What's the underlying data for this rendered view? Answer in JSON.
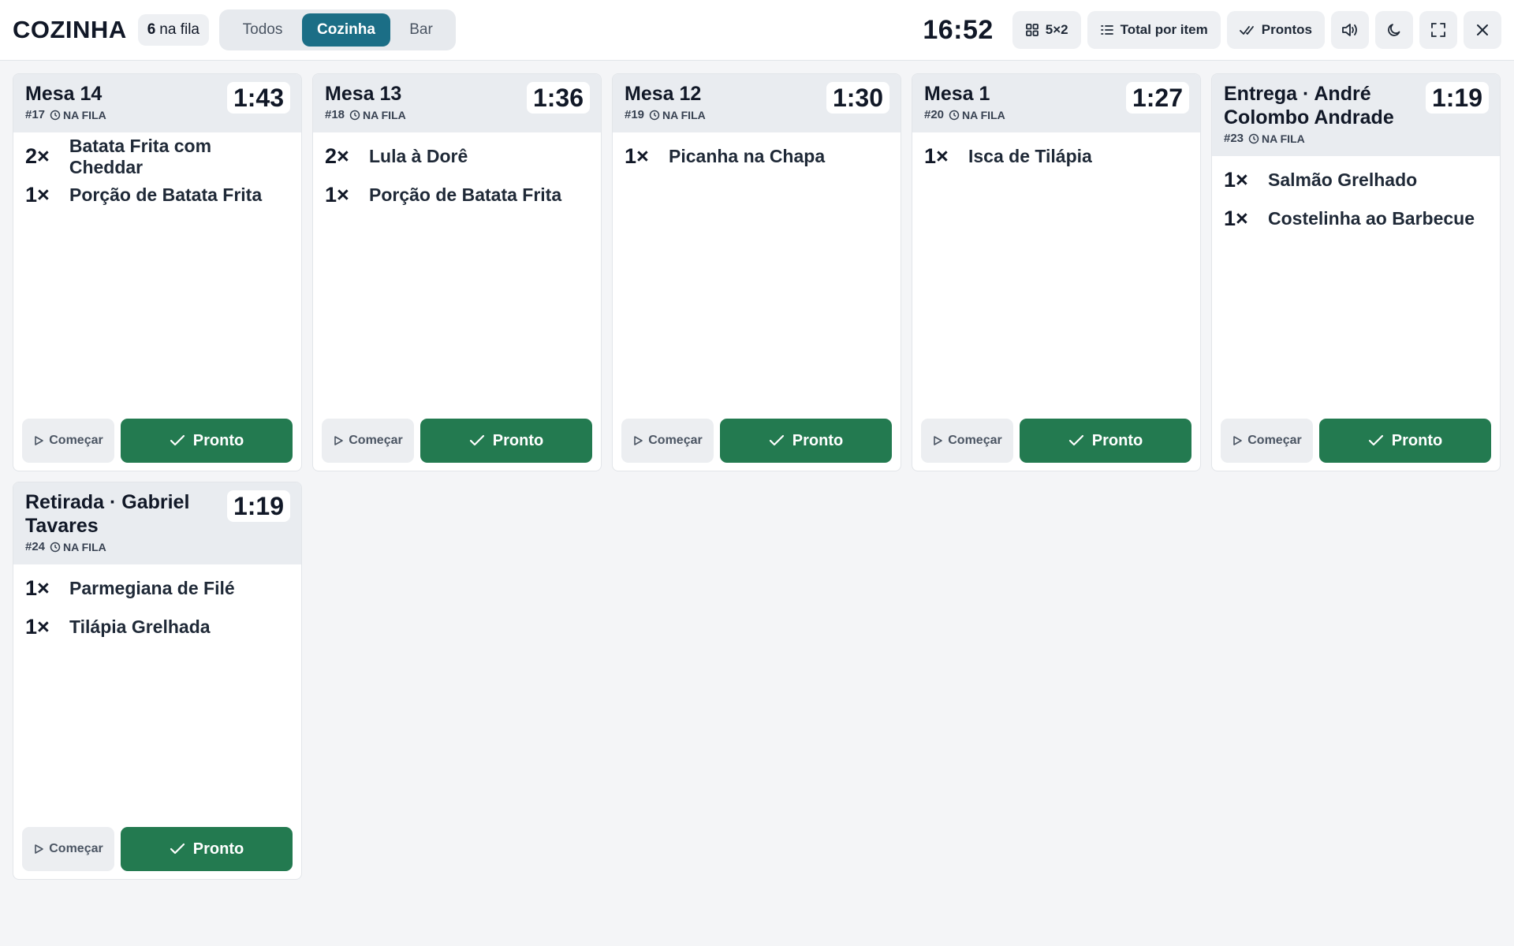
{
  "header": {
    "title": "COZINHA",
    "queue_count": "6",
    "queue_label": "na fila",
    "tabs": [
      {
        "label": "Todos",
        "active": false
      },
      {
        "label": "Cozinha",
        "active": true
      },
      {
        "label": "Bar",
        "active": false
      }
    ],
    "clock": "16:52",
    "layout_label": "5×2",
    "totals_label": "Total por item",
    "ready_filter_label": "Prontos",
    "icons": {
      "layout": "grid-icon",
      "totals": "list-icon",
      "ready": "double-check-icon",
      "sound": "speaker-icon",
      "theme": "moon-icon",
      "fullscreen": "fullscreen-icon",
      "close": "close-icon"
    }
  },
  "colors": {
    "accent": "#1b6e86",
    "ready_button": "#237a50",
    "card_header": "#e9ecf0",
    "background": "#f4f5f7"
  },
  "orders": [
    {
      "title": "Mesa 14",
      "number": "#17",
      "status": "NA FILA",
      "timer": "1:43",
      "items": [
        {
          "qty": "2×",
          "name": "Batata Frita com Cheddar"
        },
        {
          "qty": "1×",
          "name": "Porção de Batata Frita"
        }
      ],
      "start_label": "Começar",
      "ready_label": "Pronto"
    },
    {
      "title": "Mesa 13",
      "number": "#18",
      "status": "NA FILA",
      "timer": "1:36",
      "items": [
        {
          "qty": "2×",
          "name": "Lula à Dorê"
        },
        {
          "qty": "1×",
          "name": "Porção de Batata Frita"
        }
      ],
      "start_label": "Começar",
      "ready_label": "Pronto"
    },
    {
      "title": "Mesa 12",
      "number": "#19",
      "status": "NA FILA",
      "timer": "1:30",
      "items": [
        {
          "qty": "1×",
          "name": "Picanha na Chapa"
        }
      ],
      "start_label": "Começar",
      "ready_label": "Pronto"
    },
    {
      "title": "Mesa 1",
      "number": "#20",
      "status": "NA FILA",
      "timer": "1:27",
      "items": [
        {
          "qty": "1×",
          "name": "Isca de Tilápia"
        }
      ],
      "start_label": "Começar",
      "ready_label": "Pronto"
    },
    {
      "title": "Entrega · André Colombo Andrade",
      "number": "#23",
      "status": "NA FILA",
      "timer": "1:19",
      "items": [
        {
          "qty": "1×",
          "name": "Salmão Grelhado"
        },
        {
          "qty": "1×",
          "name": "Costelinha ao Barbecue"
        }
      ],
      "start_label": "Começar",
      "ready_label": "Pronto"
    },
    {
      "title": "Retirada · Gabriel Tavares",
      "number": "#24",
      "status": "NA FILA",
      "timer": "1:19",
      "items": [
        {
          "qty": "1×",
          "name": "Parmegiana de Filé"
        },
        {
          "qty": "1×",
          "name": "Tilápia Grelhada"
        }
      ],
      "start_label": "Começar",
      "ready_label": "Pronto"
    }
  ]
}
